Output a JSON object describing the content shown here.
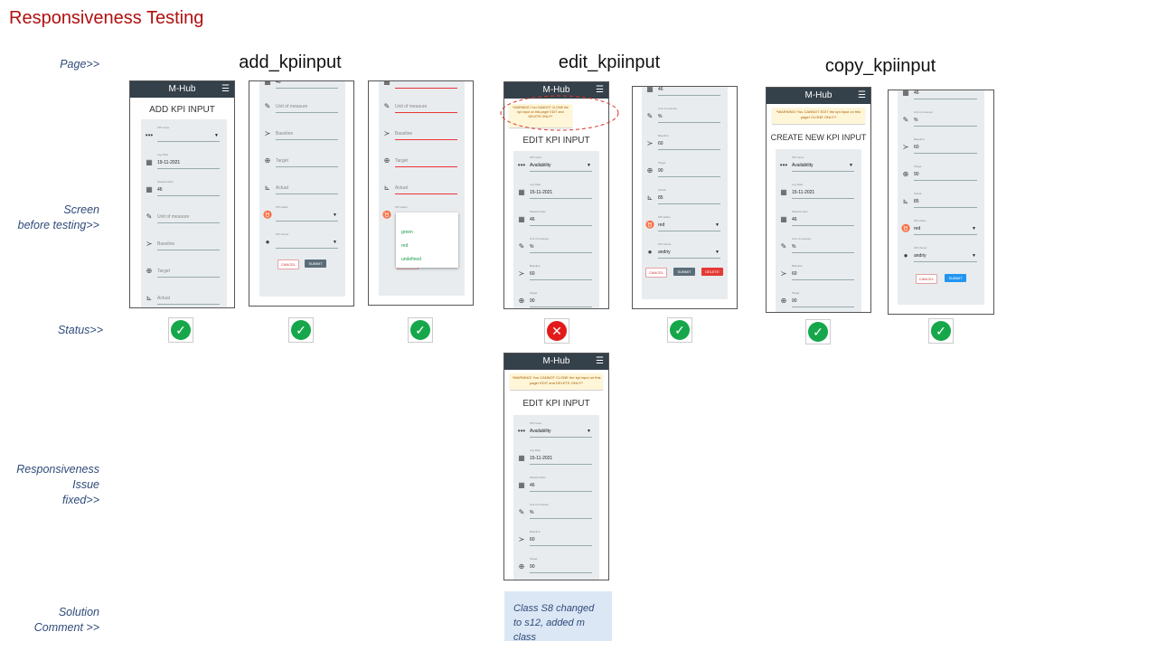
{
  "slide_title": "Responsiveness Testing",
  "row_labels": {
    "page": "Page>>",
    "screen": [
      "Screen",
      "before testing>>"
    ],
    "status": "Status>>",
    "fixed": [
      "Responsiveness",
      "Issue",
      "fixed>>"
    ],
    "comment": [
      "Solution",
      "Comment >>"
    ]
  },
  "columns": {
    "add": "add_kpiinput",
    "edit": "edit_kpiinput",
    "copy": "copy_kpiinput"
  },
  "app": {
    "name": "M-Hub",
    "menu_icon": "hamburger-icon"
  },
  "forms": {
    "add_title": "ADD KPI INPUT",
    "edit_title": "EDIT KPI INPUT",
    "copy_title": "CREATE NEW KPI INPUT"
  },
  "labels": {
    "kpi_name": "KPI name",
    "log_date": "Log Date",
    "weeknumber": "Weeknumber",
    "unit": "Unit of measure",
    "baseline": "Baseline",
    "target": "Target",
    "actual": "Actual",
    "kpi_status": "KPI status",
    "kpi_owner": "KPI Owner"
  },
  "values": {
    "log_date_add": "19-11-2021",
    "week_add": "46",
    "kpi_name": "Availability",
    "log_date": "15-11-2021",
    "week": "46",
    "unit": "%",
    "baseline": "60",
    "target": "90",
    "actual": "85",
    "status": "red",
    "owner": "andriy"
  },
  "status_options": [
    "green",
    "red",
    "undefined"
  ],
  "buttons": {
    "cancel": "CANCEL",
    "submit": "SUBMIT",
    "delete": "DELETE"
  },
  "warnings": {
    "edit": "*WARNING! You CANNOT CLONE the kpi input on this page! EDIT and DELETE ONLY!*",
    "copy": "*WARNING! You CANNOT EDIT the kpi input on this page! CLONE ONLY!*"
  },
  "status": [
    "pass",
    "pass",
    "pass",
    "fail",
    "pass",
    "pass",
    "pass"
  ],
  "status_colors": {
    "pass": "#15a74a",
    "fail": "#e21a1a",
    "highlight": "#d9332b"
  },
  "comment": "Class S8 changed to s12, added m class"
}
